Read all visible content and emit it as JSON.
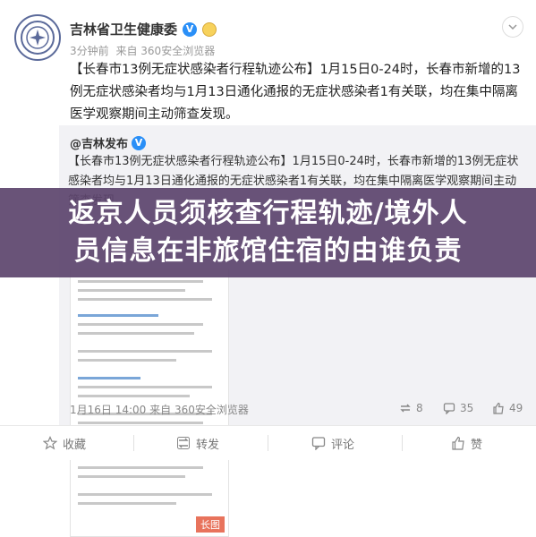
{
  "post": {
    "author": "吉林省卫生健康委",
    "time": "3分钟前",
    "source": "来自 360安全浏览器",
    "text": "【长春市13例无症状感染者行程轨迹公布】1月15日0-24时，长春市新增的13例无症状感染者均与1月13日通化通报的无症状感染者1有关联，均在集中隔离医学观察期间主动筛查发现。"
  },
  "repost": {
    "author": "@吉林发布",
    "text": "【长春市13例无症状感染者行程轨迹公布】1月15日0-24时，长春市新增的13例无症状感染者均与1月13日通化通报的无症状感染者1有关联，均在集中隔离医学观察期间主动筛查发现。",
    "image_tag": "长图",
    "time": "1月16日 14:00",
    "source": "来自 360安全浏览器",
    "stats": {
      "reposts": "8",
      "comments": "35",
      "likes": "49"
    }
  },
  "actions": {
    "favorite": "收藏",
    "repost": "转发",
    "comment": "评论",
    "like": "赞"
  },
  "overlay": {
    "line1": "返京人员须核查行程轨迹/境外人",
    "line2": "员信息在非旅馆住宿的由谁负责"
  },
  "icons": {
    "verified": "verified-icon",
    "chevron": "chevron-down-icon",
    "repost": "repost-icon",
    "comment": "comment-icon",
    "like": "thumbs-up-icon",
    "favorite": "star-icon"
  },
  "colors": {
    "overlay": "#5c446c",
    "verified": "#2a8ff7",
    "repost_bg": "#f2f2f5",
    "image_tag": "#e8735c"
  }
}
